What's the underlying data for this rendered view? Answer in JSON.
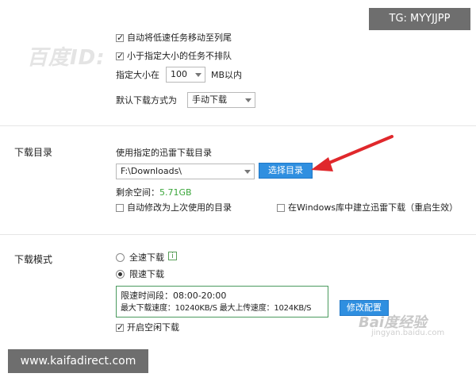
{
  "overlay": {
    "tg_label": "TG: MYYJJPP",
    "watermark_top": "百度ID:",
    "site_label": "www.kaifadirect.com",
    "baidu_watermark": "Bai度经验",
    "baidu_url": "jingyan.baidu.com"
  },
  "task_settings": {
    "move_slow_label": "自动将低速任务移动至列尾",
    "move_slow_checked": true,
    "small_first_label": "小于指定大小的任务不排队",
    "small_first_checked": true,
    "size_label": "指定大小在",
    "size_value": "100",
    "size_unit": "MB以内",
    "default_mode_label": "默认下载方式为",
    "default_mode_value": "手动下载"
  },
  "download_dir": {
    "section_label": "下载目录",
    "use_dir_label": "使用指定的迅雷下载目录",
    "path_value": "F:\\Downloads\\",
    "choose_button": "选择目录",
    "free_space_label": "剩余空间：",
    "free_space_value": "5.71GB",
    "auto_modify_label": "自动修改为上次使用的目录",
    "auto_modify_checked": false,
    "windows_lib_label": "在Windows库中建立迅雷下载（重启生效）",
    "windows_lib_checked": false
  },
  "download_mode": {
    "section_label": "下载模式",
    "full_speed_label": "全速下载",
    "full_speed_selected": false,
    "limited_label": "限速下载",
    "limited_selected": true,
    "time_line": "限速时间段：08:00-20:00",
    "speed_line": "最大下载速度：10240KB/S  最大上传速度：1024KB/S",
    "edit_button": "修改配置",
    "idle_label": "开启空闲下载",
    "idle_checked": true
  },
  "colors": {
    "accent_blue": "#2f8fe0",
    "free_space_green": "#3aa63a",
    "arrow_red": "#e0282c",
    "frame_green": "#4a9a5e"
  }
}
